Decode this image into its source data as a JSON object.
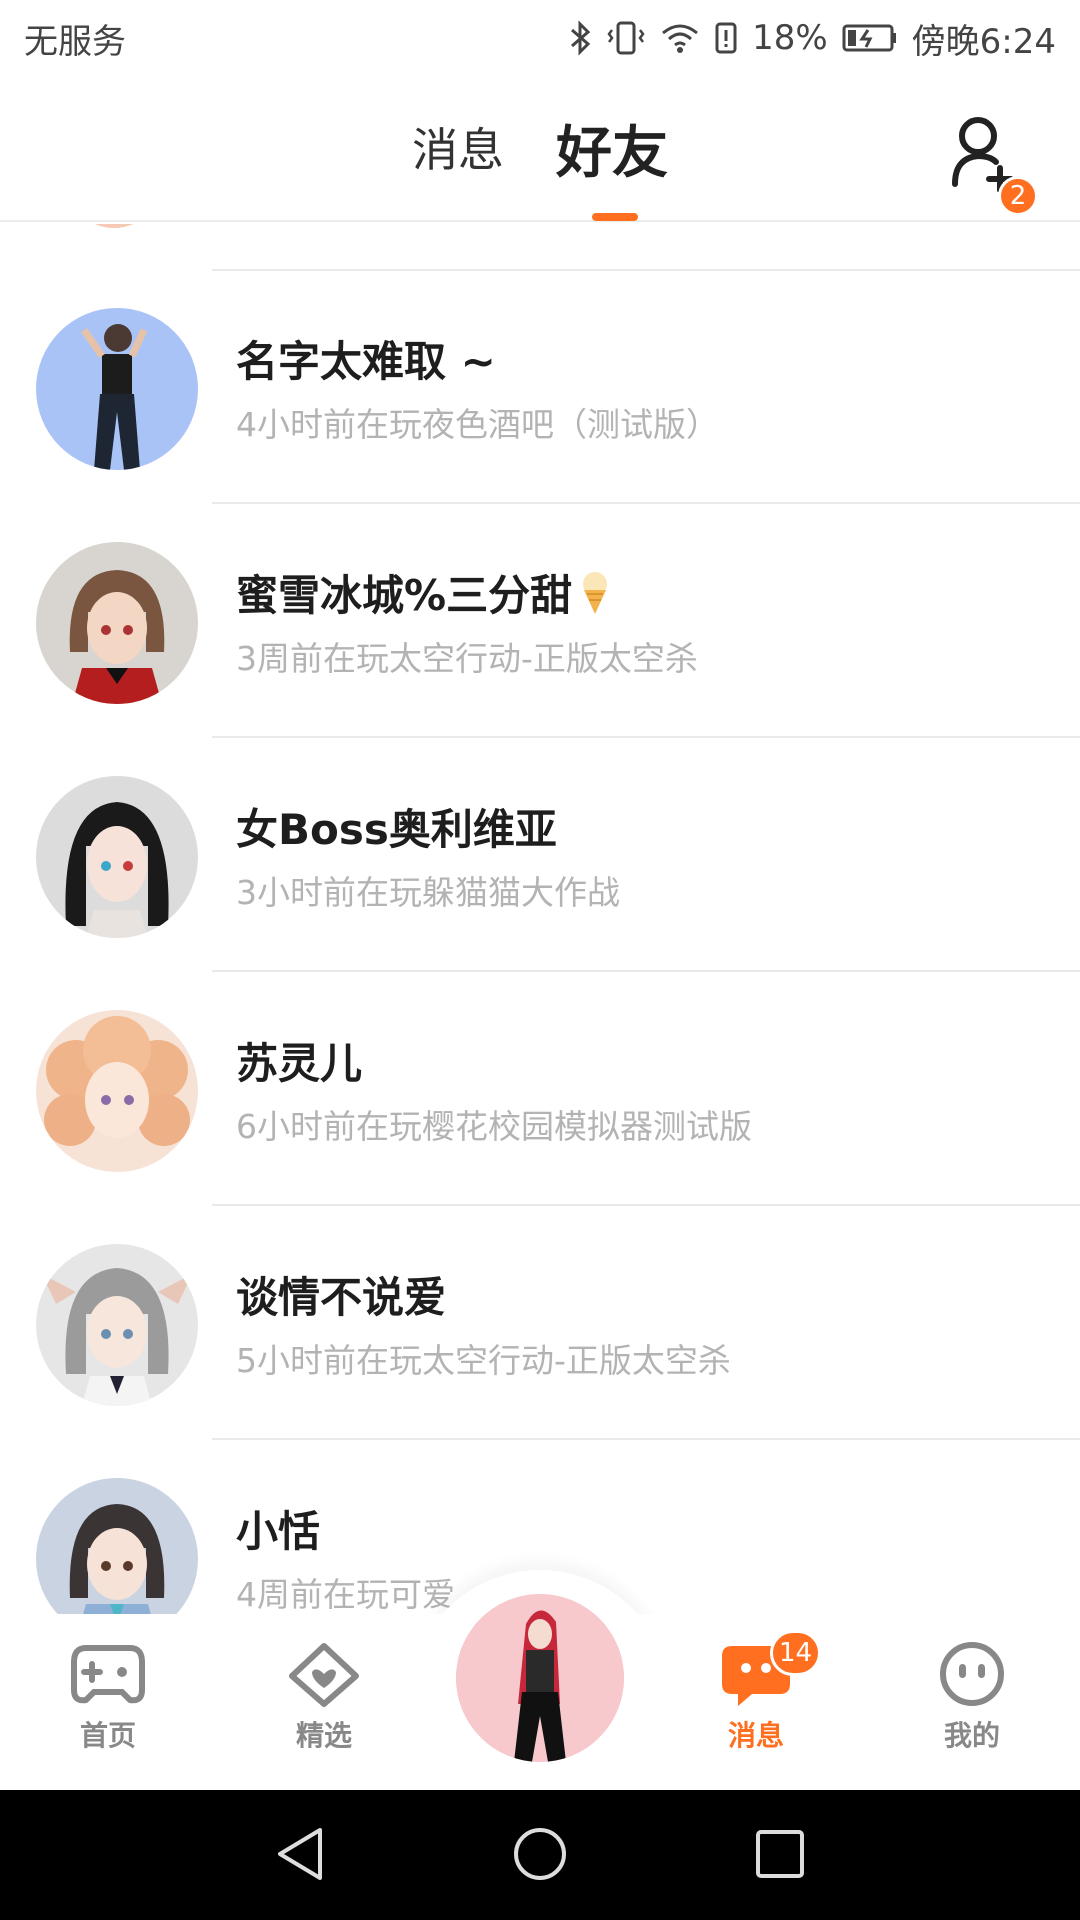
{
  "status_bar": {
    "carrier": "无服务",
    "battery": "18%",
    "time": "傍晚6:24"
  },
  "header": {
    "tabs": [
      {
        "label": "消息",
        "active": false
      },
      {
        "label": "好友",
        "active": true
      }
    ],
    "add_friend_badge": "2"
  },
  "friends": [
    {
      "name": "名字太难取 ~",
      "status": "4小时前在玩夜色酒吧（测试版）",
      "avatar_icon": "avatar-dancer"
    },
    {
      "name": "蜜雪冰城%三分甜",
      "status": "3周前在玩太空行动-正版太空杀",
      "avatar_icon": "avatar-brown-hair-girl",
      "emoji": "ice-cream-icon"
    },
    {
      "name": "女Boss奥利维亚",
      "status": "3小时前在玩躲猫猫大作战",
      "avatar_icon": "avatar-black-hair-girl"
    },
    {
      "name": "苏灵儿",
      "status": "6小时前在玩樱花校园模拟器测试版",
      "avatar_icon": "avatar-curly-hair-girl"
    },
    {
      "name": "谈情不说爱",
      "status": "5小时前在玩太空行动-正版太空杀",
      "avatar_icon": "avatar-grey-hair-girl"
    },
    {
      "name": "小恬",
      "status": "4周前在玩可爱",
      "avatar_icon": "avatar-school-girl"
    }
  ],
  "bottom_nav": {
    "items": [
      {
        "label": "首页",
        "icon": "gamepad-icon",
        "active": false
      },
      {
        "label": "精选",
        "icon": "heart-icon",
        "active": false
      },
      {
        "label": "消息",
        "icon": "chat-icon",
        "active": true,
        "badge": "14"
      },
      {
        "label": "我的",
        "icon": "face-icon",
        "active": false
      }
    ],
    "center_icon": "avatar-character"
  },
  "colors": {
    "accent": "#ff6f1f",
    "muted_text": "#b3b3b3",
    "divider": "#eaeaea"
  }
}
